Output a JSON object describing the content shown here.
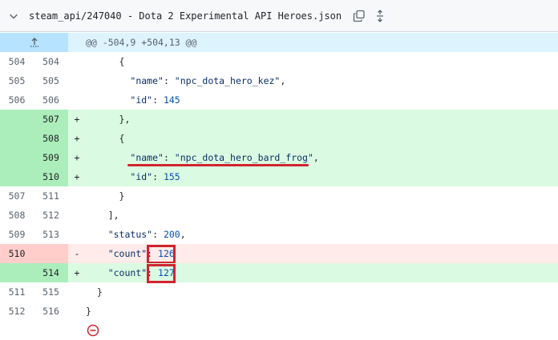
{
  "file": {
    "path": "steam_api/247040 - Dota 2 Experimental API Heroes.json"
  },
  "hunk": {
    "header": "@@ -504,9 +504,13 @@"
  },
  "lines": [
    {
      "type": "ctx",
      "old": "504",
      "new": "504",
      "marker": "",
      "code": "      {"
    },
    {
      "type": "ctx",
      "old": "505",
      "new": "505",
      "marker": "",
      "code": "        \"name\": \"npc_dota_hero_kez\","
    },
    {
      "type": "ctx",
      "old": "506",
      "new": "506",
      "marker": "",
      "code": "        \"id\": 145"
    },
    {
      "type": "add",
      "old": "",
      "new": "507",
      "marker": "+",
      "code": "      },"
    },
    {
      "type": "add",
      "old": "",
      "new": "508",
      "marker": "+",
      "code": "      {"
    },
    {
      "type": "add",
      "old": "",
      "new": "509",
      "marker": "+",
      "code": "        \"name\": \"npc_dota_hero_bard_frog\","
    },
    {
      "type": "add",
      "old": "",
      "new": "510",
      "marker": "+",
      "code": "        \"id\": 155"
    },
    {
      "type": "ctx",
      "old": "507",
      "new": "511",
      "marker": "",
      "code": "      }"
    },
    {
      "type": "ctx",
      "old": "508",
      "new": "512",
      "marker": "",
      "code": "    ],"
    },
    {
      "type": "ctx",
      "old": "509",
      "new": "513",
      "marker": "",
      "code": "    \"status\": 200,"
    },
    {
      "type": "del",
      "old": "510",
      "new": "",
      "marker": "-",
      "code": "    \"count\": 126"
    },
    {
      "type": "add",
      "old": "",
      "new": "514",
      "marker": "+",
      "code": "    \"count\": 127"
    },
    {
      "type": "ctx",
      "old": "511",
      "new": "515",
      "marker": "",
      "code": "  }"
    },
    {
      "type": "ctx",
      "old": "512",
      "new": "516",
      "marker": "",
      "code": "}"
    }
  ],
  "colors": {
    "addition_bg": "#dafbe1",
    "addition_gutter": "#aceebb",
    "deletion_bg": "#ffebe9",
    "deletion_gutter": "#ffcecb",
    "hunk_bg": "#ddf4ff",
    "annotation_red": "#d1242f"
  },
  "icons": {
    "collapse": "chevron-down-icon",
    "copy": "copy-icon",
    "expand": "unfold-icon",
    "hunk_expand": "expand-up-icon",
    "end": "no-newline-icon"
  }
}
